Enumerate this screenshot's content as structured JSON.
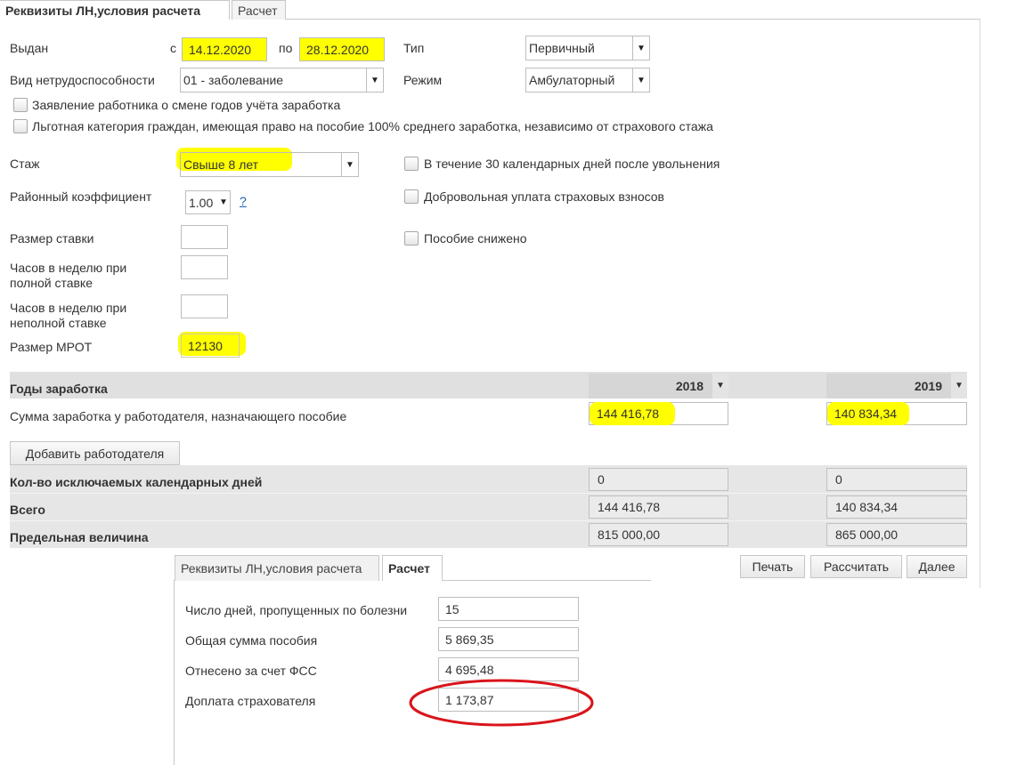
{
  "tabs_top": [
    {
      "label": "Реквизиты ЛН,условия расчета"
    },
    {
      "label": "Расчет"
    }
  ],
  "issued": {
    "label": "Выдан",
    "from_label": "с",
    "from": "14.12.2020",
    "to_label": "по",
    "to": "28.12.2020"
  },
  "type": {
    "label": "Тип",
    "value": "Первичный"
  },
  "disability": {
    "label": "Вид нетрудоспособности",
    "value": "01 - заболевание"
  },
  "mode": {
    "label": "Режим",
    "value": "Амбулаторный"
  },
  "checkboxes": {
    "change_years": "Заявление работника о смене годов учёта заработка",
    "privileged": "Льготная категория граждан, имеющая право на пособие 100% среднего заработка, независимо от страхового стажа",
    "after_dismissal": "В течение 30 календарных дней после увольнения",
    "voluntary": "Добровольная уплата страховых взносов",
    "reduced": "Пособие снижено"
  },
  "seniority": {
    "label": "Стаж",
    "value": "Свыше 8 лет"
  },
  "regional": {
    "label": "Районный коэффициент",
    "value": "1.00",
    "help": "?"
  },
  "rate": {
    "label": "Размер ставки",
    "value": ""
  },
  "hours_full": {
    "label": "Часов в неделю при полной ставке",
    "value": ""
  },
  "hours_part": {
    "label": "Часов в неделю при неполной ставке",
    "value": ""
  },
  "mrot": {
    "label": "Размер МРОТ",
    "value": "12130"
  },
  "years": {
    "title": "Годы заработка",
    "year1": "2018",
    "year2": "2019",
    "earnings_label": "Сумма заработка у работодателя, назначающего пособие",
    "earnings1": "144 416,78",
    "earnings2": "140 834,34"
  },
  "add_employer": "Добавить работодателя",
  "excluded": {
    "label": "Кол-во исключаемых календарных дней",
    "v1": "0",
    "v2": "0"
  },
  "total": {
    "label": "Всего",
    "v1": "144 416,78",
    "v2": "140 834,34"
  },
  "limit": {
    "label": "Предельная величина",
    "v1": "815 000,00",
    "v2": "865 000,00"
  },
  "buttons": {
    "print": "Печать",
    "calculate": "Рассчитать",
    "next": "Далее"
  },
  "tabs_bottom": [
    {
      "label": "Реквизиты ЛН,условия расчета"
    },
    {
      "label": "Расчет"
    }
  ],
  "calc": {
    "days": {
      "label": "Число дней, пропущенных по болезни",
      "value": "15"
    },
    "total": {
      "label": "Общая сумма пособия",
      "value": "5 869,35"
    },
    "fss": {
      "label": "Отнесено за счет ФСС",
      "value": "4 695,48"
    },
    "employer": {
      "label": "Доплата страхователя",
      "value": "1 173,87"
    }
  },
  "colors": {
    "highlight": "#ffff00",
    "circle": "#d9141a"
  }
}
